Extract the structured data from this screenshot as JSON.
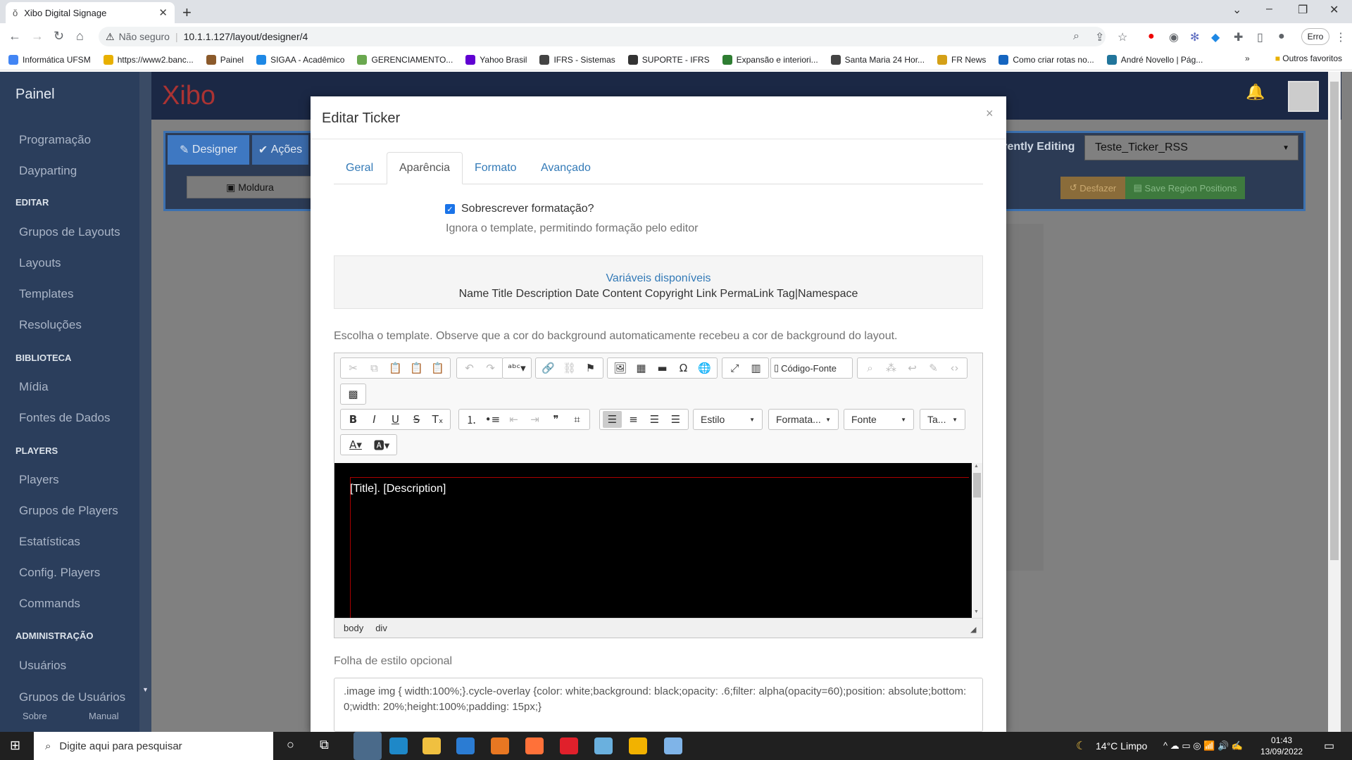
{
  "browser": {
    "tab_title": "Xibo Digital Signage",
    "address_prefix": "Não seguro",
    "url": "10.1.1.127/layout/designer/4",
    "profile_label": "Erro",
    "bookmarks": [
      "Informática UFSM",
      "https://www2.banc...",
      "Painel",
      "SIGAA - Acadêmico",
      "GERENCIAMENTO...",
      "Yahoo Brasil",
      "IFRS - Sistemas",
      "SUPORTE - IFRS",
      "Expansão e interiori...",
      "Santa Maria 24 Hor...",
      "FR News",
      "Como criar rotas no...",
      "André Novello | Pág..."
    ],
    "bookmark_colors": [
      "#4285f4",
      "#e8b000",
      "#8b5a2b",
      "#1e88e5",
      "#6aa84f",
      "#6001d2",
      "#444444",
      "#333333",
      "#2e7d32",
      "#444444",
      "#d4a017",
      "#1565c0",
      "#21759b"
    ],
    "other_favorites": "Outros favoritos"
  },
  "sidebar": {
    "title": "Painel",
    "items": [
      {
        "type": "item",
        "label": "Programação"
      },
      {
        "type": "item",
        "label": "Dayparting"
      },
      {
        "type": "section",
        "label": "EDITAR"
      },
      {
        "type": "item",
        "label": "Grupos de Layouts"
      },
      {
        "type": "item",
        "label": "Layouts"
      },
      {
        "type": "item",
        "label": "Templates"
      },
      {
        "type": "item",
        "label": "Resoluções"
      },
      {
        "type": "section",
        "label": "BIBLIOTECA"
      },
      {
        "type": "item",
        "label": "Mídia"
      },
      {
        "type": "item",
        "label": "Fontes de Dados"
      },
      {
        "type": "section",
        "label": "PLAYERS"
      },
      {
        "type": "item",
        "label": "Players"
      },
      {
        "type": "item",
        "label": "Grupos de Players"
      },
      {
        "type": "item",
        "label": "Estatísticas"
      },
      {
        "type": "item",
        "label": "Config. Players"
      },
      {
        "type": "item",
        "label": "Commands"
      },
      {
        "type": "section",
        "label": "ADMINISTRAÇÃO"
      },
      {
        "type": "item",
        "label": "Usuários"
      },
      {
        "type": "item",
        "label": "Grupos de Usuários"
      }
    ],
    "footer_left": "Sobre",
    "footer_right": "Manual"
  },
  "app": {
    "logo": "Xibo",
    "tab_designer": "Designer",
    "tab_actions": "Ações",
    "moldura_button": "Moldura",
    "currently_editing_label": "rrently Editing",
    "layout_selected": "Teste_Ticker_RSS",
    "undo_button": "Desfazer",
    "save_region_button": "Save Region Positions"
  },
  "modal": {
    "title": "Editar Ticker",
    "tabs": [
      "Geral",
      "Aparência",
      "Formato",
      "Avançado"
    ],
    "active_tab": "Aparência",
    "override_label": "Sobrescrever formatação?",
    "override_checked": true,
    "override_help": "Ignora o template, permitindo formação pelo editor",
    "variables_title": "Variáveis disponíveis",
    "variables_list": "Name Title Description Date Content Copyright Link PermaLink Tag|Namespace",
    "template_help": "Escolha o template. Observe que a cor do background automaticamente recebeu a cor de background do layout.",
    "source_button": "Código-Fonte",
    "combo_style": "Estilo",
    "combo_format": "Formata...",
    "combo_font": "Fonte",
    "combo_size": "Ta...",
    "editor_content": "[Title]. [Description]",
    "path_items": [
      "body",
      "div"
    ],
    "stylesheet_label": "Folha de estilo opcional",
    "stylesheet_value": ".image img { width:100%;}.cycle-overlay {color: white;background: black;opacity: .6;filter: alpha(opacity=60);position: absolute;bottom: 0;width: 20%;height:100%;padding: 15px;}"
  },
  "taskbar": {
    "search_placeholder": "Digite aqui para pesquisar",
    "weather": "14°C  Limpo",
    "time": "01:43",
    "date": "13/09/2022"
  }
}
